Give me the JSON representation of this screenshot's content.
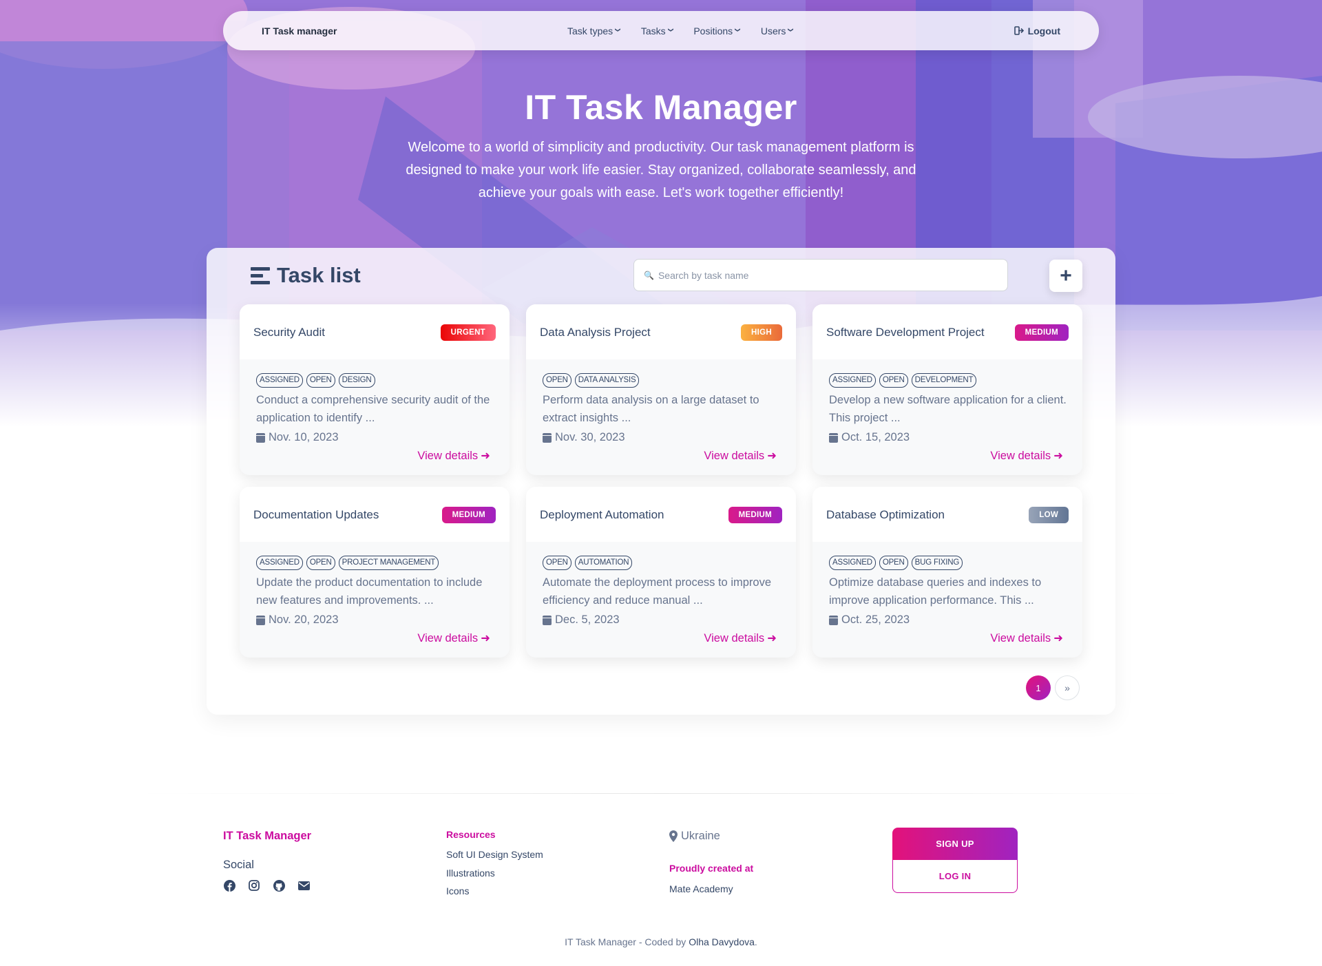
{
  "navbar": {
    "brand": "IT Task manager",
    "menu": [
      {
        "label": "Task types"
      },
      {
        "label": "Tasks"
      },
      {
        "label": "Positions"
      },
      {
        "label": "Users"
      }
    ],
    "logout": "Logout"
  },
  "hero": {
    "title": "IT Task Manager",
    "subtitle": "Welcome to a world of simplicity and productivity. Our task management platform is designed to make your work life easier. Stay organized, collaborate seamlessly, and achieve your goals with ease. Let's work together efficiently!"
  },
  "tasklist": {
    "title": "Task list",
    "search_placeholder": "Search by task name",
    "add_label": "+",
    "details_label": "View details",
    "cards": [
      {
        "name": "Security Audit",
        "priority": "URGENT",
        "priority_class": "urgent",
        "tags": [
          "ASSIGNED",
          "OPEN",
          "DESIGN"
        ],
        "description": "Conduct a comprehensive security audit of the application to identify ...",
        "date": "Nov. 10, 2023"
      },
      {
        "name": "Data Analysis Project",
        "priority": "HIGH",
        "priority_class": "high",
        "tags": [
          "OPEN",
          "DATA ANALYSIS"
        ],
        "description": "Perform data analysis on a large dataset to extract insights ...",
        "date": "Nov. 30, 2023"
      },
      {
        "name": "Software Development Project",
        "priority": "MEDIUM",
        "priority_class": "medium",
        "tags": [
          "ASSIGNED",
          "OPEN",
          "DEVELOPMENT"
        ],
        "description": "Develop a new software application for a client. This project ...",
        "date": "Oct. 15, 2023"
      },
      {
        "name": "Documentation Updates",
        "priority": "MEDIUM",
        "priority_class": "medium",
        "tags": [
          "ASSIGNED",
          "OPEN",
          "PROJECT MANAGEMENT"
        ],
        "description": "Update the product documentation to include new features and improvements. ...",
        "date": "Nov. 20, 2023"
      },
      {
        "name": "Deployment Automation",
        "priority": "MEDIUM",
        "priority_class": "medium",
        "tags": [
          "OPEN",
          "AUTOMATION"
        ],
        "description": "Automate the deployment process to improve efficiency and reduce manual ...",
        "date": "Dec. 5, 2023"
      },
      {
        "name": "Database Optimization",
        "priority": "LOW",
        "priority_class": "low",
        "tags": [
          "ASSIGNED",
          "OPEN",
          "BUG FIXING"
        ],
        "description": "Optimize database queries and indexes to improve application performance. This ...",
        "date": "Oct. 25, 2023"
      }
    ],
    "pagination": {
      "current": "1",
      "next": "»"
    }
  },
  "footer": {
    "brand": "IT Task Manager",
    "social_title": "Social",
    "social_icons": [
      "facebook-icon",
      "instagram-icon",
      "github-icon",
      "envelope-icon"
    ],
    "resources_title": "Resources",
    "resources": [
      "Soft UI Design System",
      "Illustrations",
      "Icons"
    ],
    "location": "Ukraine",
    "proudly_title": "Proudly created at",
    "proudly_name": "Mate Academy",
    "signup": "SIGN UP",
    "login": "LOG IN",
    "copyright_prefix": "IT Task Manager - Coded by ",
    "copyright_author": "Olha Davydova",
    "copyright_suffix": "."
  },
  "colors": {
    "primary": "#cb0c9f",
    "text_dark": "#344767",
    "text_muted": "#67748e"
  }
}
